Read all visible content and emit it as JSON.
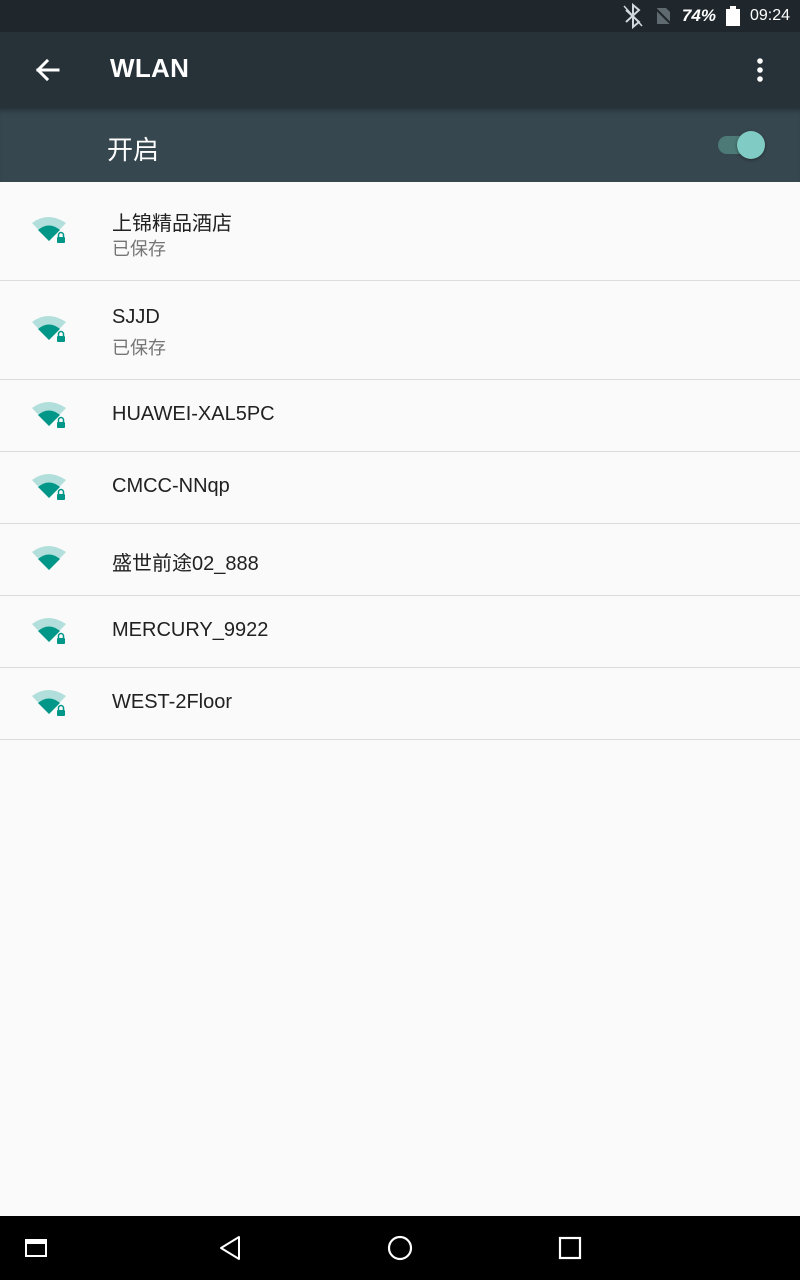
{
  "status_bar": {
    "battery_percent": "74%",
    "time": "09:24",
    "icons": [
      "bluetooth-icon",
      "no-sim-icon",
      "battery-icon"
    ]
  },
  "app_bar": {
    "title": "WLAN",
    "back_icon": "arrow-back-icon",
    "overflow_icon": "more-vert-icon"
  },
  "master_switch": {
    "label": "开启",
    "on": true
  },
  "networks": [
    {
      "name": "上锦精品酒店",
      "status": "已保存",
      "secured": true,
      "signal_bars": 3
    },
    {
      "name": "SJJD",
      "status": "已保存",
      "secured": true,
      "signal_bars": 3
    },
    {
      "name": "HUAWEI-XAL5PC",
      "status": "",
      "secured": true,
      "signal_bars": 3
    },
    {
      "name": "CMCC-NNqp",
      "status": "",
      "secured": true,
      "signal_bars": 3
    },
    {
      "name": "盛世前途02_888",
      "status": "",
      "secured": false,
      "signal_bars": 3
    },
    {
      "name": "MERCURY_9922",
      "status": "",
      "secured": true,
      "signal_bars": 3
    },
    {
      "name": "WEST-2Floor",
      "status": "",
      "secured": true,
      "signal_bars": 3
    }
  ],
  "nav_bar": {
    "icons": [
      "screenshot-icon",
      "nav-back-icon",
      "nav-home-icon",
      "nav-recents-icon"
    ]
  },
  "colors": {
    "status_bar": "#1f272c",
    "app_bar": "#263238",
    "switch_bar": "#37474f",
    "accent": "#009688",
    "accent_light": "#80cbc4",
    "background": "#fafafa"
  }
}
